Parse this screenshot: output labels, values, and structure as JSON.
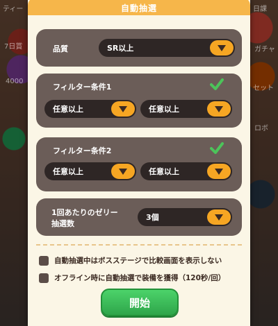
{
  "background": {
    "left_texts": [
      "ティー",
      "7日賞",
      "4000"
    ],
    "right_texts": [
      "日課",
      "ガチャ",
      "セット",
      "ロボ"
    ]
  },
  "dialog": {
    "title": "自動抽選",
    "quality": {
      "label": "品質",
      "value": "SR以上"
    },
    "filter1": {
      "label": "フィルター条件1",
      "checked": true,
      "left_value": "任意以上",
      "right_value": "任意以上"
    },
    "filter2": {
      "label": "フィルター条件2",
      "checked": true,
      "left_value": "任意以上",
      "right_value": "任意以上"
    },
    "jelly": {
      "label_line1": "1回あたりのゼリー",
      "label_line2": "抽選数",
      "value": "3個"
    },
    "options": [
      {
        "label": "自動抽選中はボスステージで比較画面を表示しない",
        "checked": false
      },
      {
        "label": "オフライン時に自動抽選で装備を獲得（120秒/回）",
        "checked": false
      }
    ],
    "start_label": "開始"
  },
  "colors": {
    "header": "#f6b64a",
    "panel": "#6b5d58",
    "dropdown": "#2e2625",
    "arrow": "#f6a623",
    "check": "#4cc45a",
    "start": "#2ea54a"
  }
}
